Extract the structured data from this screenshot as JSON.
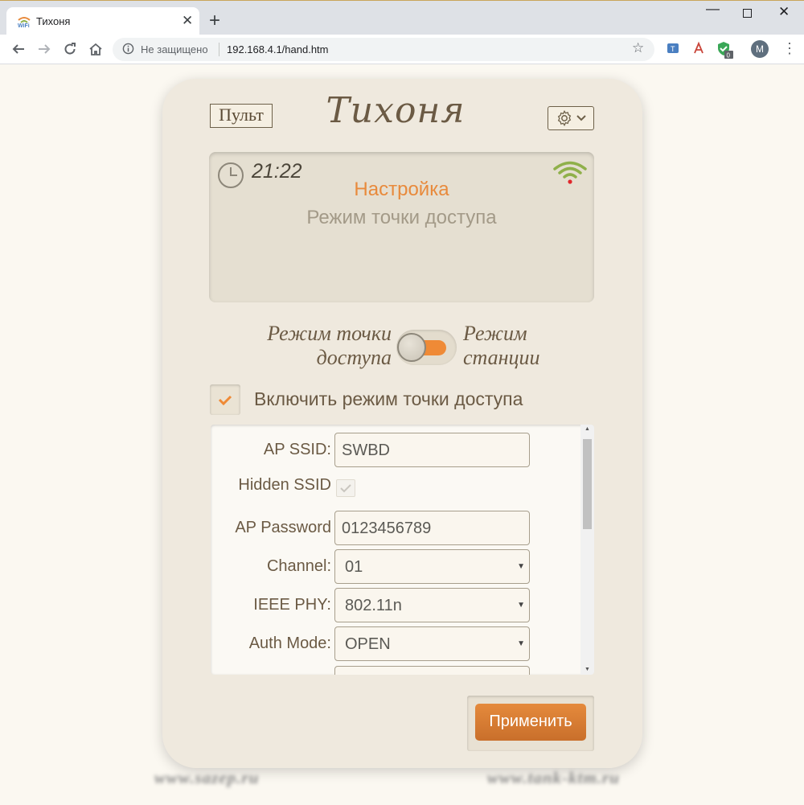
{
  "browser": {
    "tab_title": "Тихоня",
    "new_tab": "+",
    "security_label": "Не защищено",
    "url": "192.168.4.1/hand.htm",
    "profile_initial": "M",
    "ext_badge": "0"
  },
  "header": {
    "pult_label": "Пульт",
    "title": "Тихоня"
  },
  "status": {
    "time": "21:22",
    "title": "Настройка",
    "subtitle": "Режим точки доступа",
    "wifi_color": "#8fb04a",
    "wifi_dot_color": "#e0282c"
  },
  "mode_switch": {
    "left_line1": "Режим точки",
    "left_line2": "доступа",
    "right_line1": "Режим",
    "right_line2": "станции",
    "state": "ap"
  },
  "ap_enable": {
    "label": "Включить режим точки доступа",
    "checked": true
  },
  "form": {
    "ssid_label": "AP SSID:",
    "ssid_value": "SWBD",
    "hidden_label": "Hidden SSID",
    "hidden_checked": true,
    "password_label": "AP Password",
    "password_value": "0123456789",
    "channel_label": "Channel:",
    "channel_value": "01",
    "phy_label": "IEEE PHY:",
    "phy_value": "802.11n",
    "auth_label": "Auth Mode:",
    "auth_value": "OPEN"
  },
  "apply_label": "Применить",
  "footer": {
    "left": "www.sazep.ru",
    "right": "www.tank-ktm.ru"
  },
  "colors": {
    "accent": "#e88a3c",
    "text_brown": "#6b5a44",
    "card_bg": "#efe9de",
    "page_bg": "#fbf8f1"
  }
}
